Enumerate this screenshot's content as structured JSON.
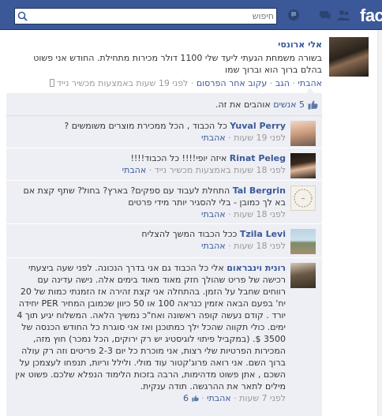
{
  "topbar": {
    "brand": "fac",
    "search_placeholder": "חיפוש",
    "icons": [
      "friends-icon",
      "messages-icon",
      "notifications-icon",
      "search-icon"
    ]
  },
  "post": {
    "author": "אלי ארונסי",
    "text": "בשורה משמחת הגעתי ליעד שלי 1100 דולר מכירות מתחילת. החודש אני פשוט בהלם ברוך הוא וברוך שמו",
    "meta": {
      "like": "אהבתי",
      "comment": "הגב",
      "unfollow": "עקוב אחר הפרסום",
      "time": "לפני 19 שעות באמצעות מכשיר נייד"
    }
  },
  "ufi": {
    "likes_count": "5 אנשים",
    "likes_suffix": "אוהבים את זה.",
    "comments": [
      {
        "name": "Yuval Perry",
        "text": "כל הכבוד , הכל ממכירת מוצרים משומשים ?",
        "time": "לפני 19 שעות",
        "like": "אהבתי",
        "like_count": ""
      },
      {
        "name": "Rinat Peleg",
        "text": "איזה יופי!!!! כל הכבוד!!!!",
        "time": "לפני 18 שעות באמצעות מכשיר נייד",
        "like": "אהבתי",
        "like_count": ""
      },
      {
        "name": "Tal Bergrin",
        "text": "התחלת לעבוד עם ספקים? בארץ? בחול? שתף קצת אם בא לך כמובן - בלי להסגיר יותר מידי פרטים",
        "time": "לפני 18 שעות",
        "like": "אהבתי",
        "like_count": ""
      },
      {
        "name": "Tzila Levi",
        "text": "ככל הכבוד המשך להצליח",
        "time": "לפני 18 שעות",
        "like": "אהבתי",
        "like_count": ""
      },
      {
        "name": "רונית וינבראום",
        "text": "אלי כל הכבוד גם אני בדרך הנכונה. לפני שעה ביצעתי רכישה של פריט שהולך חזק מאוד מאוד בימים אלה. נישה עדינה עם רווחים שחבל על הזמן. בהתחלה אני קצת זהירה אז הזמנתי כמות של 20 יח' בפעם הבאה אזמין כנראה 100 או 50 כיוון שכמובן המחיר PER יחידה יורד . קודם נעשה קופה ראשונה ואח\"כ נמשיך הלאה. המשלוח יגיע תוך 4 ימים. כולי תקווה שהכל ילך כמתוכנן ואז אני סוגרת כל החודש הכנסה של 3500 $. (במקביל פיתוי לוגיסטיג יש רק ירוקים, הכל נמכר) חוץ מזה, המכירות הפרטיות שלי רצות, אני מוכרת כל יום 2-3 פריטים וזה רק עולה ברוך השם. אני רואה פרוג'קטור עוד מולי. ולילל וריות, תנפחו לעצמכן על השכם , אתן פשוט מדהימות, הרבה בזכות הלימוד הנפלא שלכם. פשוט אין מילים לתאר את ההרגשה. תודה ענקית.",
        "time": "לפני 7 שעות",
        "like": "אהבתי",
        "like_count": "6"
      }
    ]
  },
  "colors": {
    "brand_blue": "#3b5998",
    "ufi_bg": "#edeff4",
    "meta_gray": "#999999"
  }
}
